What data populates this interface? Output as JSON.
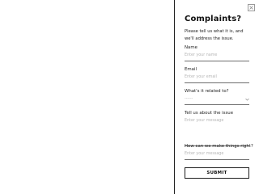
{
  "form": {
    "title": "Complaints?",
    "intro": "Please tell us what it is, and we'll address the issue.",
    "name": {
      "label": "Name",
      "placeholder": "Enter your name"
    },
    "email": {
      "label": "Email",
      "placeholder": "Enter your email"
    },
    "topic": {
      "label": "What's it related to?",
      "selected": "------"
    },
    "issue": {
      "label": "Tell us about the issue",
      "placeholder": "Enter your message"
    },
    "resolution": {
      "label": "How can we make things right?",
      "placeholder": "Enter your message"
    },
    "submit_label": "SUBMIT"
  },
  "icons": {
    "close": "close-icon",
    "dropdown": "chevron-down-icon"
  }
}
